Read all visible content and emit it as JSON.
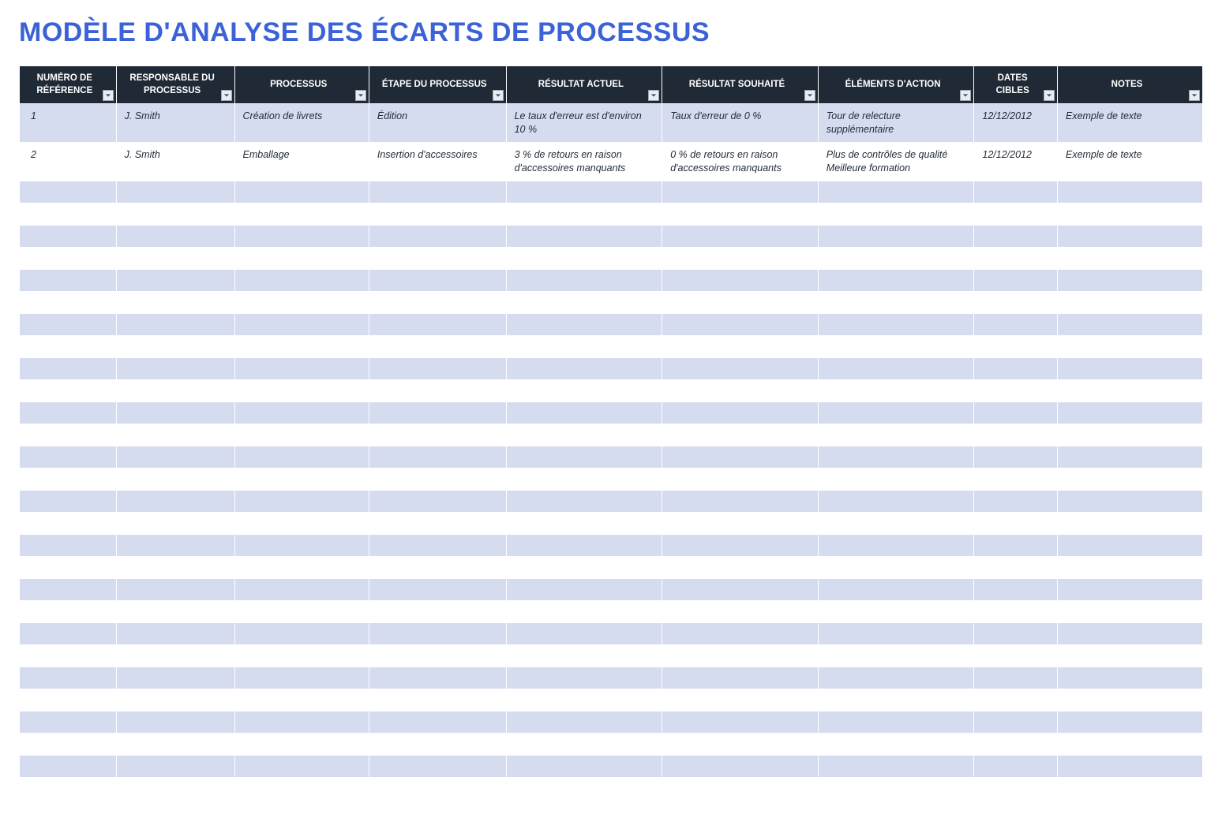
{
  "title": "MODÈLE D'ANALYSE DES ÉCARTS DE PROCESSUS",
  "columns": [
    "NUMÉRO DE RÉFÉRENCE",
    "RESPONSABLE DU PROCESSUS",
    "PROCESSUS",
    "ÉTAPE DU PROCESSUS",
    "RÉSULTAT ACTUEL",
    "RÉSULTAT SOUHAITÉ",
    "ÉLÉMENTS D'ACTION",
    "DATES CIBLES",
    "NOTES"
  ],
  "rows": [
    {
      "ref": "1",
      "owner": "J. Smith",
      "process": "Création de livrets",
      "step": "Édition",
      "current": "Le taux d'erreur est d'environ 10 %",
      "desired": "Taux d'erreur de 0 %",
      "actions": "Tour de relecture supplémentaire",
      "date": "12/12/2012",
      "notes": "Exemple de texte"
    },
    {
      "ref": "2",
      "owner": "J. Smith",
      "process": "Emballage",
      "step": "Insertion d'accessoires",
      "current": "3 % de retours en raison d'accessoires manquants",
      "desired": "0 % de retours en raison d'accessoires manquants",
      "actions": "Plus de contrôles de qualité Meilleure formation",
      "date": "12/12/2012",
      "notes": "Exemple de texte"
    }
  ],
  "empty_rows": 28
}
